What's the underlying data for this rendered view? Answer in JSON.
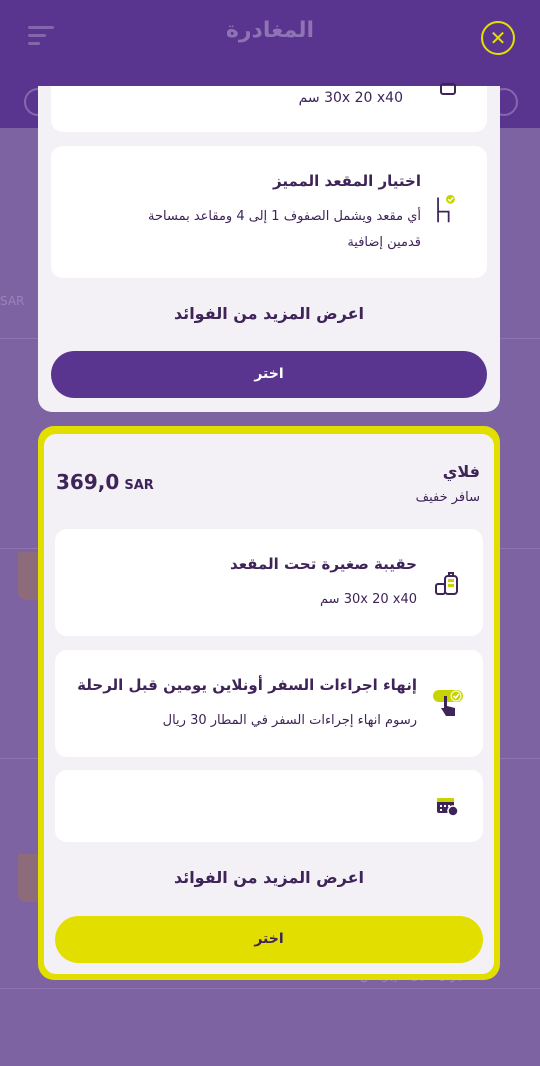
{
  "header": {
    "title": "المغادرة"
  },
  "top_sheet": {
    "partial_card": {
      "subtitle": "30x 20 x40 سم"
    },
    "seat_card": {
      "title": "اختيار المقعد المميز",
      "subtitle_line1": "أي مقعد ويشمل الصفوف 1 إلى 4 ومقاعد بمساحة",
      "subtitle_line2": "قدمين إضافية"
    },
    "more_label": "اعرض المزيد من الفوائد",
    "select_label": "اختر"
  },
  "fare_card": {
    "name": "فلاي",
    "description": "سافر خفيف",
    "currency": "SAR",
    "price": "369,0",
    "features": [
      {
        "title": "حقيبة صغيرة تحت المقعد",
        "subtitle": "30x 20 x40 سم",
        "icon": "small-bag-icon"
      },
      {
        "title": "إنهاء اجراءات السفر أونلاين يومين قبل الرحلة",
        "subtitle": "رسوم انهاء إجراءات السفر في المطار 30 ريال",
        "icon": "online-checkin-icon"
      },
      {
        "title": "",
        "subtitle": "",
        "icon": "calendar-change-icon"
      }
    ],
    "more_label": "اعرض المزيد من الفوائد",
    "select_label": "اختر"
  },
  "background": {
    "route_text": "طيران أديل - إيرباص A320",
    "currency_hint": "SAR"
  },
  "colors": {
    "purple": "#5a3590",
    "yellow": "#e2df00",
    "dark_text": "#3e2458"
  }
}
